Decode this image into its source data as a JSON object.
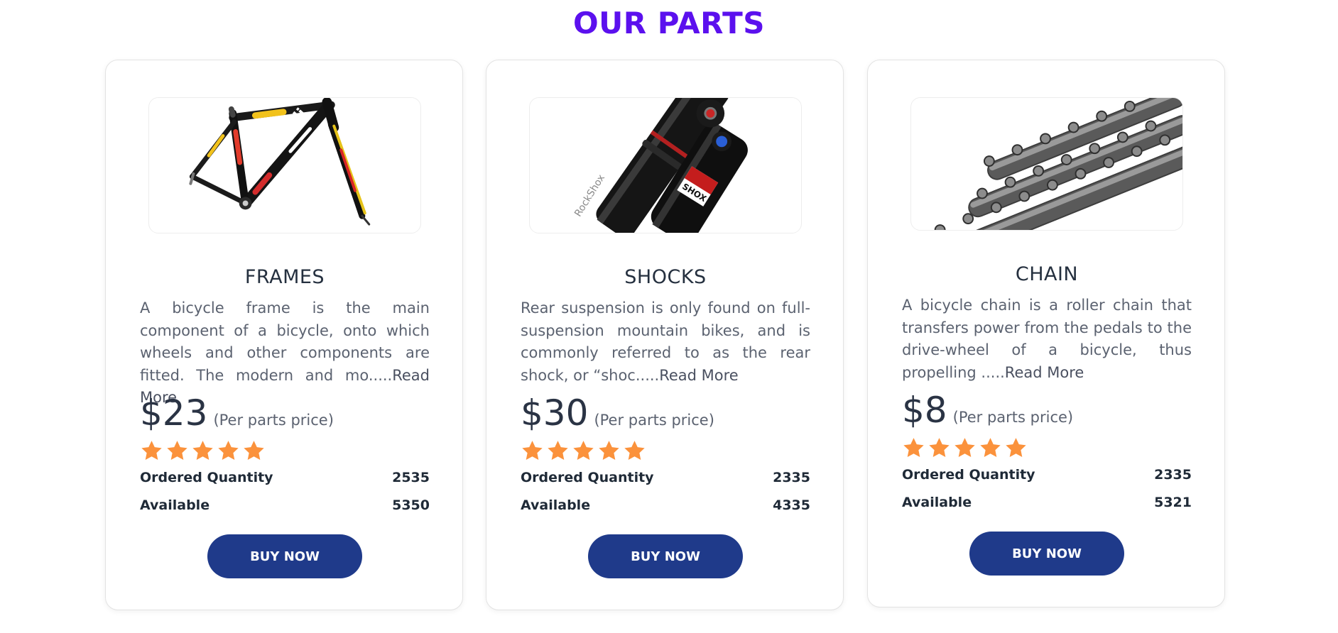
{
  "section": {
    "title": "OUR PARTS"
  },
  "colors": {
    "title": "#5b10ee",
    "button": "#1f3a8a",
    "star": "#fb923c"
  },
  "products": [
    {
      "name": "FRAMES",
      "image_icon": "bicycle-frame-image",
      "description": "A bicycle frame is the main component of a bicycle, onto which wheels and other components are fitted. The modern and mo.....",
      "read_more": "Read More",
      "price": "$23",
      "price_note": "(Per parts price)",
      "rating": 5,
      "ordered_label": "Ordered Quantity",
      "ordered_value": "2535",
      "available_label": "Available",
      "available_value": "5350",
      "button_label": "BUY NOW"
    },
    {
      "name": "SHOCKS",
      "image_icon": "rear-shock-image",
      "description": "Rear suspension is only found on full-suspension mountain bikes, and is commonly referred to as the rear shock, or “shoc.....",
      "read_more": "Read More",
      "price": "$30",
      "price_note": "(Per parts price)",
      "rating": 5,
      "ordered_label": "Ordered Quantity",
      "ordered_value": "2335",
      "available_label": "Available",
      "available_value": "4335",
      "button_label": "BUY NOW"
    },
    {
      "name": "CHAIN",
      "image_icon": "bicycle-chain-image",
      "description": "A bicycle chain is a roller chain that transfers power from the pedals to the drive-wheel of a bicycle, thus propelling .....",
      "read_more": "Read More",
      "price": "$8",
      "price_note": "(Per parts price)",
      "rating": 5,
      "ordered_label": "Ordered Quantity",
      "ordered_value": "2335",
      "available_label": "Available",
      "available_value": "5321",
      "button_label": "BUY NOW"
    }
  ]
}
